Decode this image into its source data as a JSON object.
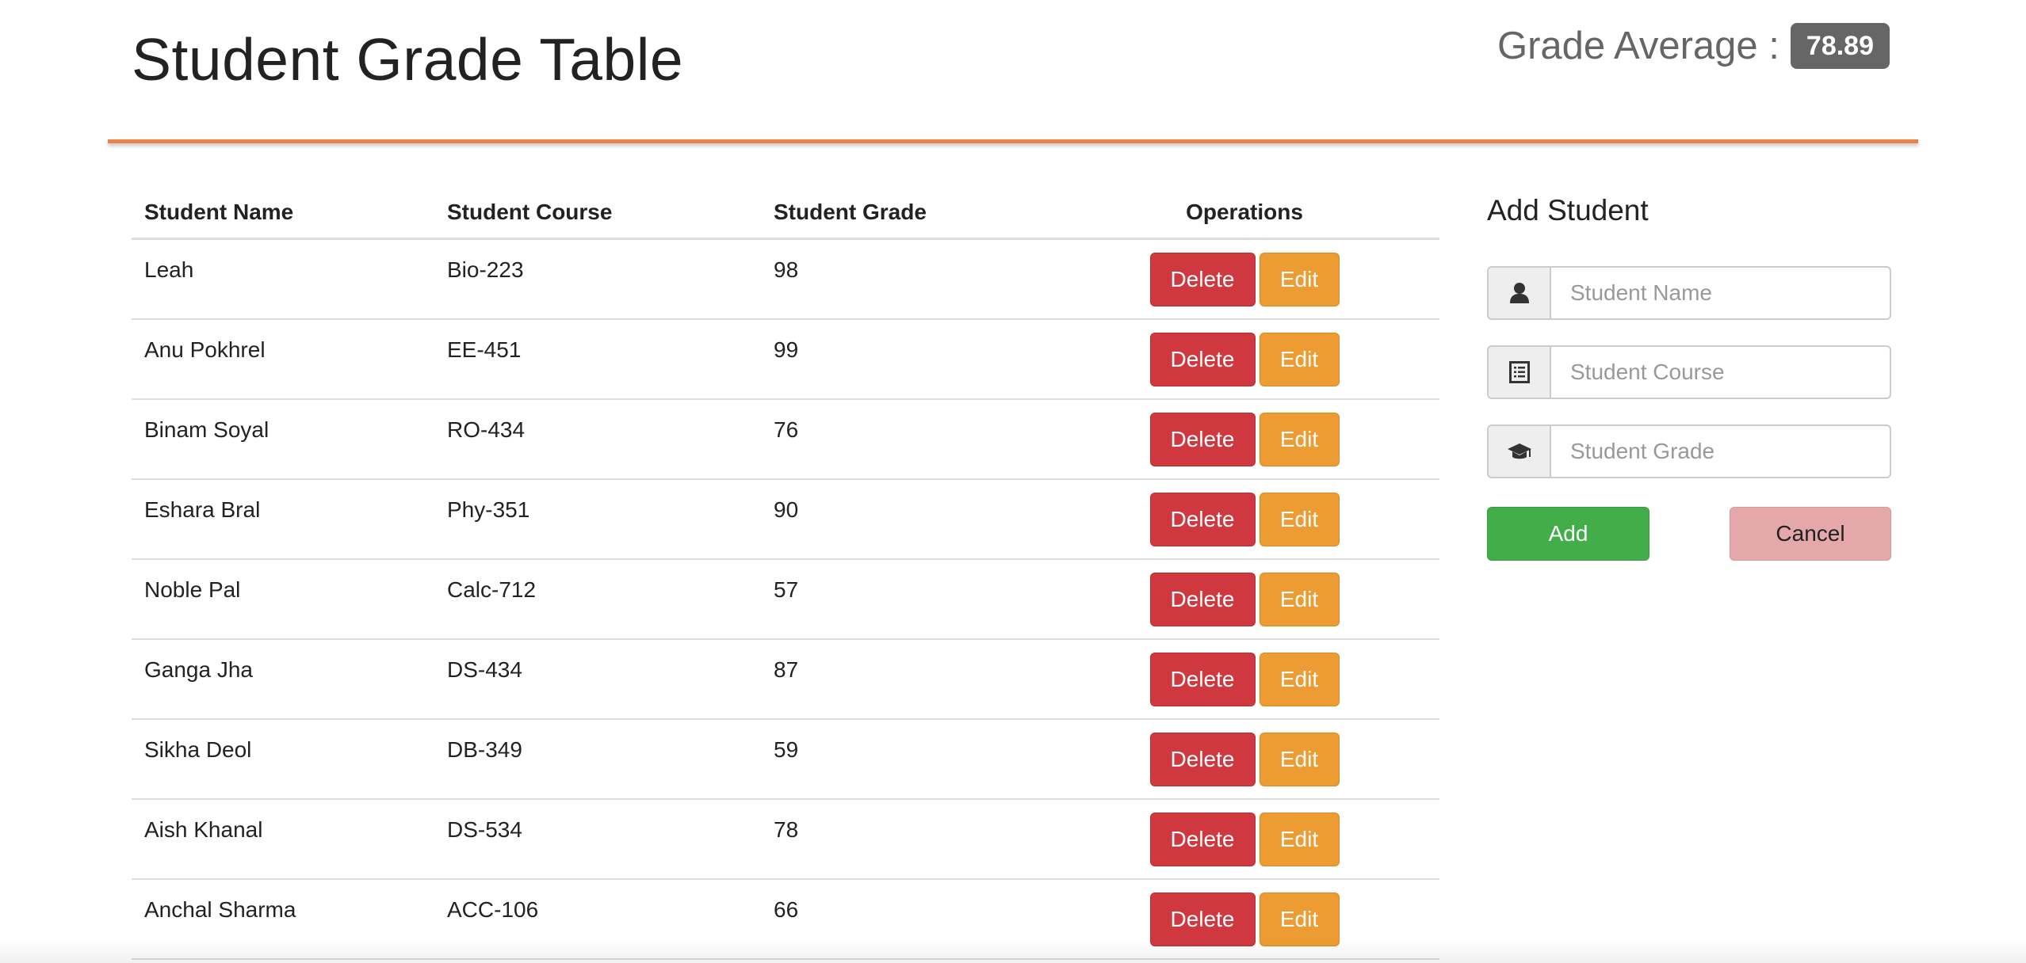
{
  "header": {
    "title": "Student Grade Table",
    "average_label": "Grade Average :",
    "average_value": "78.89"
  },
  "table": {
    "columns": [
      "Student Name",
      "Student Course",
      "Student Grade",
      "Operations"
    ],
    "delete_label": "Delete",
    "edit_label": "Edit",
    "rows": [
      {
        "name": "Leah",
        "course": "Bio-223",
        "grade": "98"
      },
      {
        "name": "Anu Pokhrel",
        "course": "EE-451",
        "grade": "99"
      },
      {
        "name": "Binam Soyal",
        "course": "RO-434",
        "grade": "76"
      },
      {
        "name": "Eshara Bral",
        "course": "Phy-351",
        "grade": "90"
      },
      {
        "name": "Noble Pal",
        "course": "Calc-712",
        "grade": "57"
      },
      {
        "name": "Ganga Jha",
        "course": "DS-434",
        "grade": "87"
      },
      {
        "name": "Sikha Deol",
        "course": "DB-349",
        "grade": "59"
      },
      {
        "name": "Aish Khanal",
        "course": "DS-534",
        "grade": "78"
      },
      {
        "name": "Anchal Sharma",
        "course": "ACC-106",
        "grade": "66"
      }
    ]
  },
  "form": {
    "title": "Add Student",
    "name_placeholder": "Student Name",
    "course_placeholder": "Student Course",
    "grade_placeholder": "Student Grade",
    "name_icon": "user-icon",
    "course_icon": "list-icon",
    "grade_icon": "graduation-cap-icon",
    "add_label": "Add",
    "cancel_label": "Cancel"
  },
  "colors": {
    "accent_divider": "#e8834a",
    "delete": "#d0383f",
    "edit": "#ed9c34",
    "add": "#43ad49",
    "cancel": "#e5a8aa",
    "badge": "#666666"
  }
}
